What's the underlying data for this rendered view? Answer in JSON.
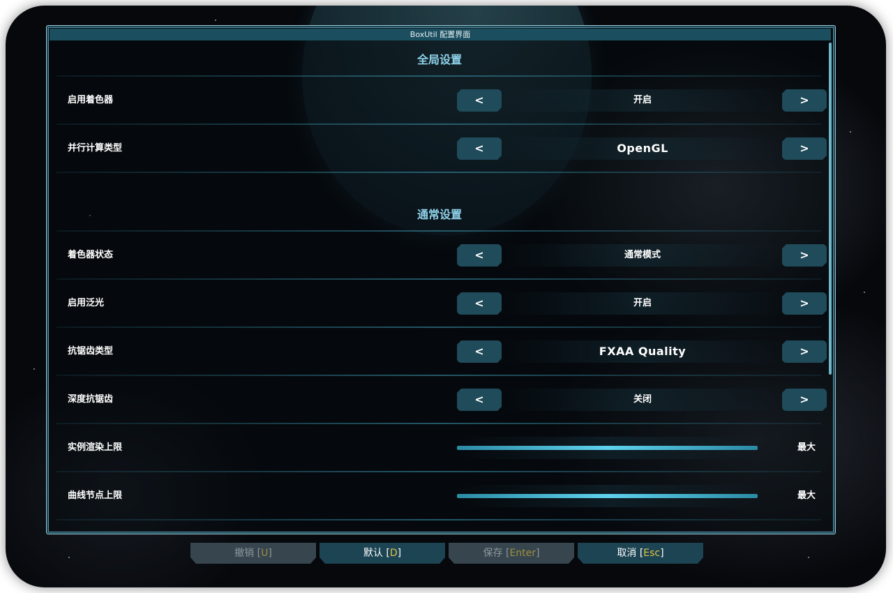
{
  "window": {
    "title": "BoxUtil 配置界面"
  },
  "sections": [
    {
      "title": "全局设置"
    },
    {
      "title": "通常设置"
    }
  ],
  "arrows": {
    "prev": "<",
    "next": ">"
  },
  "settings": [
    {
      "label": "启用着色器",
      "value": "开启"
    },
    {
      "label": "并行计算类型",
      "value": "OpenGL"
    },
    {
      "label": "着色器状态",
      "value": "通常模式"
    },
    {
      "label": "启用泛光",
      "value": "开启"
    },
    {
      "label": "抗锯齿类型",
      "value": "FXAA Quality"
    },
    {
      "label": "深度抗锯齿",
      "value": "关闭"
    }
  ],
  "sliders": [
    {
      "label": "实例渲染上限",
      "value": "最大",
      "level": 1.0
    },
    {
      "label": "曲线节点上限",
      "value": "最大",
      "level": 1.0
    }
  ],
  "footer": {
    "undo": {
      "label": "撤销 [",
      "key": "U",
      "end": "]"
    },
    "default": {
      "label": "默认 [",
      "key": "D",
      "end": "]"
    },
    "save": {
      "label": "保存 [",
      "key": "Enter",
      "end": "]"
    },
    "cancel": {
      "label": "取消 [",
      "key": "Esc",
      "end": "]"
    }
  },
  "colors": {
    "accent": "#8fd3ea",
    "button": "#1f4b5a",
    "key_highlight": "#e6c443"
  }
}
